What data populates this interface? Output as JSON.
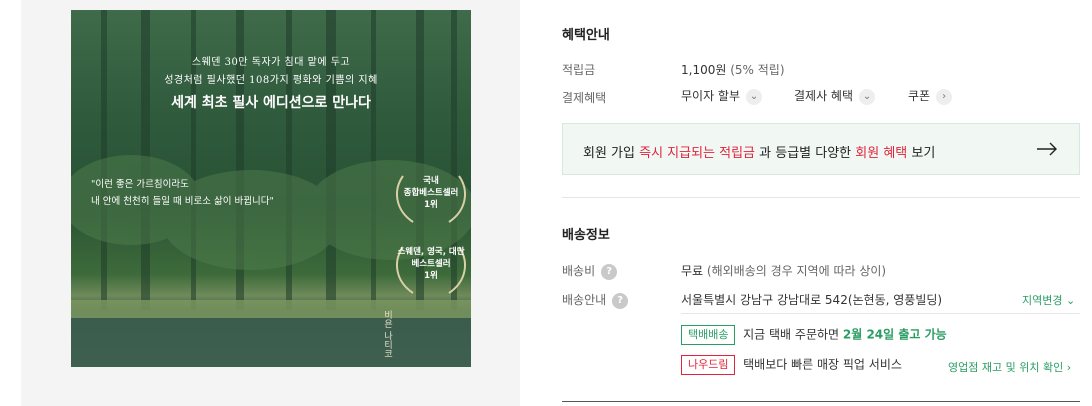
{
  "cover": {
    "line1": "스웨덴 30만 독자가 침대 맡에 두고",
    "line2": "성경처럼 필사했던 108가지 평화와 기쁨의 지혜",
    "headline": "세계 최초 필사 에디션으로 만나다",
    "quote1": "\"이런 좋은 가르침이라도",
    "quote2": "내 안에 천천히 들일 때 비로소 삶이 바뀝니다\"",
    "badge1": [
      "국내",
      "종합베스트셀러",
      "1위"
    ],
    "badge2": [
      "스웨덴, 영국, 대만",
      "베스트셀러",
      "1위"
    ],
    "signature": "비욘 나티코"
  },
  "benefits": {
    "title": "혜택안내",
    "points_label": "적립금",
    "points_value": "1,100원",
    "points_rate": "(5% 적립)",
    "payment_label": "결제혜택",
    "installment": "무이자 할부",
    "card_benefit": "결제사 혜택",
    "coupon": "쿠폰"
  },
  "promo": {
    "prefix": "회원 가입 ",
    "highlight1": "즉시 지급되는 적립금",
    "middle": " 과 등급별 다양한 ",
    "highlight2": "회원 혜택",
    "suffix": " 보기"
  },
  "delivery": {
    "title": "배송정보",
    "fee_label": "배송비",
    "fee_value": "무료",
    "fee_note": "(해외배송의 경우 지역에 따라 상이)",
    "guide_label": "배송안내",
    "address": "서울특별시 강남구 강남대로 542(논현동, 영풍빌딩)",
    "change_region": "지역변경",
    "parcel_tag": "택배배송",
    "parcel_text_prefix": "지금 택배 주문하면 ",
    "parcel_text_strong": "2월 24일 출고 가능",
    "pickup_tag": "나우드림",
    "pickup_text": "택배보다 빠른 매장 픽업 서비스",
    "pickup_link": "영업점 재고 및 위치 확인"
  }
}
